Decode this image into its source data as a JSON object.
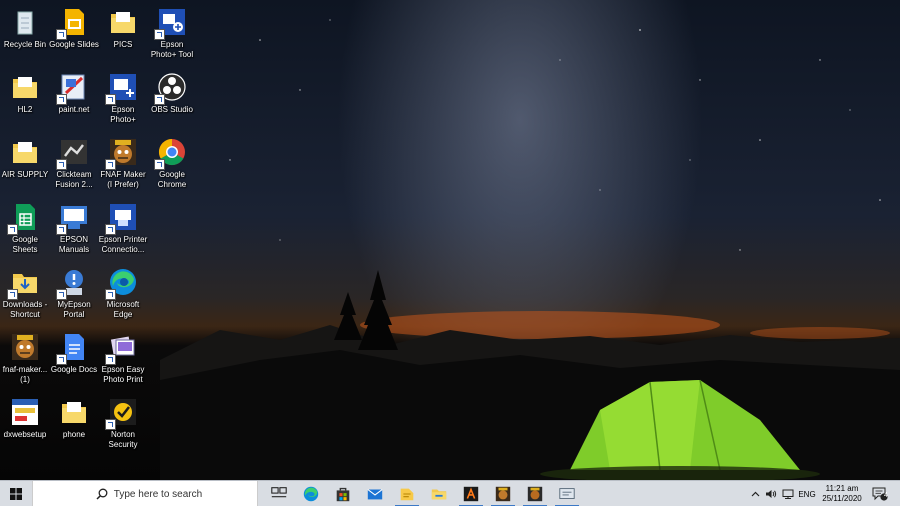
{
  "desktop_icons": [
    {
      "label": "Recycle Bin",
      "icon": "recycle-bin-icon",
      "shortcut": false
    },
    {
      "label": "Google Slides",
      "icon": "google-slides-icon",
      "shortcut": true
    },
    {
      "label": "PICS",
      "icon": "folder-icon",
      "shortcut": false
    },
    {
      "label": "Epson Photo+ Tool",
      "icon": "epson-photo-tool-icon",
      "shortcut": true
    },
    {
      "label": "HL2",
      "icon": "folder-icon",
      "shortcut": false
    },
    {
      "label": "paint.net",
      "icon": "paint-net-icon",
      "shortcut": true
    },
    {
      "label": "Epson Photo+",
      "icon": "epson-photo-icon",
      "shortcut": true
    },
    {
      "label": "OBS Studio",
      "icon": "obs-studio-icon",
      "shortcut": true
    },
    {
      "label": "AIR SUPPLY",
      "icon": "folder-icon",
      "shortcut": false
    },
    {
      "label": "Clickteam Fusion 2...",
      "icon": "clickteam-fusion-icon",
      "shortcut": true
    },
    {
      "label": "FNAF Maker (I Prefer)",
      "icon": "fnaf-maker-icon",
      "shortcut": true
    },
    {
      "label": "Google Chrome",
      "icon": "google-chrome-icon",
      "shortcut": true
    },
    {
      "label": "Google Sheets",
      "icon": "google-sheets-icon",
      "shortcut": true
    },
    {
      "label": "EPSON Manuals",
      "icon": "epson-manuals-icon",
      "shortcut": true
    },
    {
      "label": "Epson Printer Connectio...",
      "icon": "epson-printer-connection-icon",
      "shortcut": true
    },
    {
      "label": "Downloads - Shortcut",
      "icon": "downloads-folder-icon",
      "shortcut": true
    },
    {
      "label": "MyEpson Portal",
      "icon": "myepson-portal-icon",
      "shortcut": true
    },
    {
      "label": "Microsoft Edge",
      "icon": "microsoft-edge-icon",
      "shortcut": true
    },
    {
      "label": "fnaf-maker... (1)",
      "icon": "fnaf-maker-icon",
      "shortcut": false
    },
    {
      "label": "Google Docs",
      "icon": "google-docs-icon",
      "shortcut": true
    },
    {
      "label": "Epson Easy Photo Print",
      "icon": "epson-easy-photo-print-icon",
      "shortcut": true
    },
    {
      "label": "dxwebsetup",
      "icon": "dxwebsetup-icon",
      "shortcut": false
    },
    {
      "label": "phone",
      "icon": "folder-icon",
      "shortcut": false
    },
    {
      "label": "Norton Security",
      "icon": "norton-security-icon",
      "shortcut": true
    }
  ],
  "taskbar": {
    "search_placeholder": "Type here to search",
    "pinned": [
      {
        "name": "task-view-icon"
      },
      {
        "name": "microsoft-edge-icon"
      },
      {
        "name": "microsoft-store-icon"
      },
      {
        "name": "mail-icon"
      },
      {
        "name": "sticky-notes-folder-icon"
      },
      {
        "name": "file-explorer-icon"
      },
      {
        "name": "half-life-icon"
      },
      {
        "name": "game-app-icon"
      },
      {
        "name": "game-app-2-icon"
      },
      {
        "name": "network-app-icon"
      }
    ],
    "tray": {
      "language": "ENG",
      "time": "11:21 am",
      "date": "25/11/2020",
      "notification_count": "4"
    }
  }
}
